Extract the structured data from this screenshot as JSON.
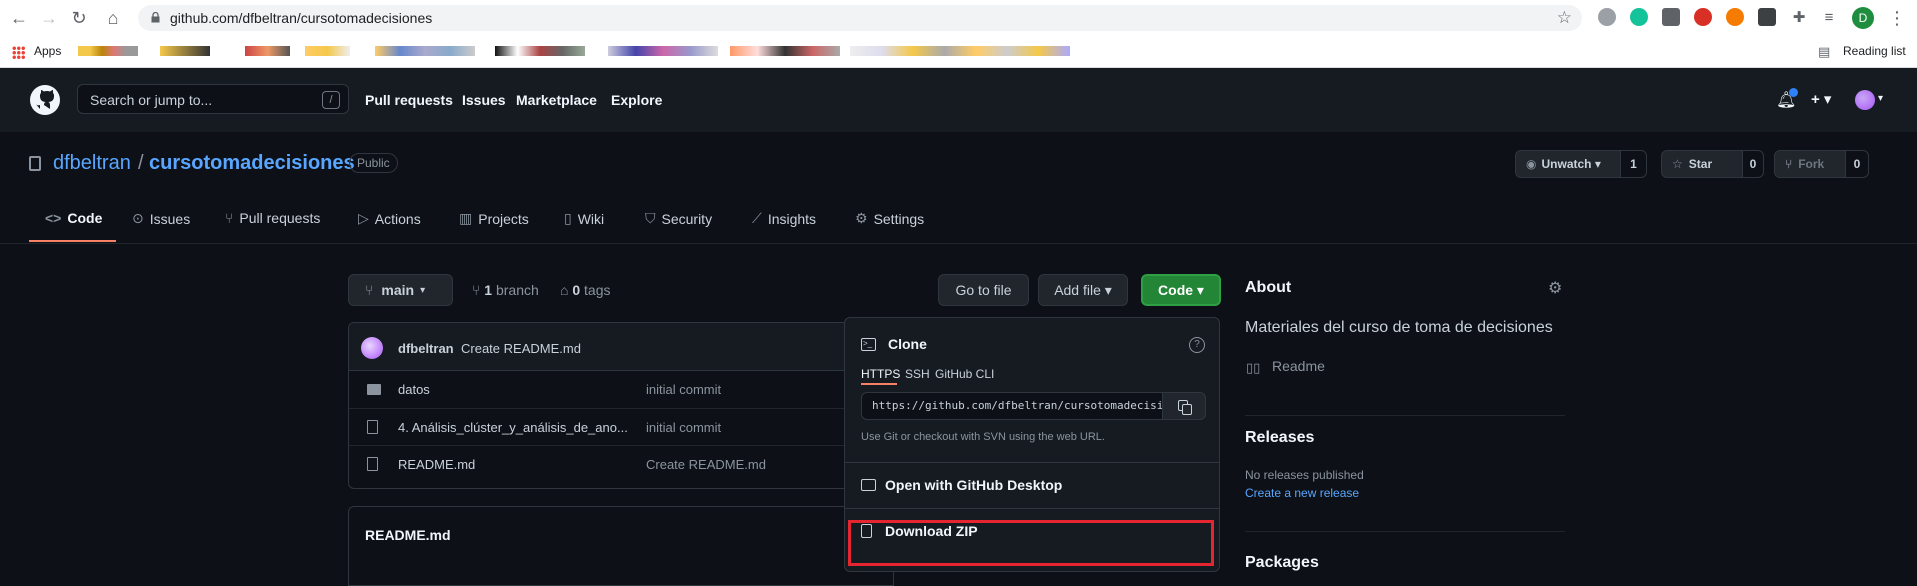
{
  "browser": {
    "url": "github.com/dfbeltran/cursotomadecisiones",
    "apps_label": "Apps",
    "reading_list": "Reading list",
    "profile_initial": "D"
  },
  "gh_header": {
    "search_placeholder": "Search or jump to...",
    "slash": "/",
    "nav": [
      "Pull requests",
      "Issues",
      "Marketplace",
      "Explore"
    ],
    "plus": "+ ▾"
  },
  "repo": {
    "owner": "dfbeltran",
    "separator": "/",
    "name": "cursotomadecisiones",
    "visibility": "Public",
    "unwatch_label": "Unwatch ▾",
    "unwatch_count": "1",
    "star_label": "Star",
    "star_count": "0",
    "fork_label": "Fork",
    "fork_count": "0"
  },
  "tabs": [
    "Code",
    "Issues",
    "Pull requests",
    "Actions",
    "Projects",
    "Wiki",
    "Security",
    "Insights",
    "Settings"
  ],
  "toolbar": {
    "branch": "main",
    "branch_count": "1",
    "branch_word": "branch",
    "tag_count": "0",
    "tag_word": "tags",
    "go_to_file": "Go to file",
    "add_file": "Add file ▾",
    "code": "Code ▾"
  },
  "commit": {
    "author": "dfbeltran",
    "message": "Create README.md"
  },
  "files": [
    {
      "name": "datos",
      "message": "initial commit",
      "type": "folder"
    },
    {
      "name": "4. Análisis_clúster_y_análisis_de_ano...",
      "message": "initial commit",
      "type": "file"
    },
    {
      "name": "README.md",
      "message": "Create README.md",
      "type": "file"
    }
  ],
  "readme_title": "README.md",
  "clone": {
    "title": "Clone",
    "help": "?",
    "tabs": [
      "HTTPS",
      "SSH",
      "GitHub CLI"
    ],
    "url": "https://github.com/dfbeltran/cursotomadecisiones.git",
    "hint": "Use Git or checkout with SVN using the web URL.",
    "open_desktop": "Open with GitHub Desktop",
    "download_zip": "Download ZIP"
  },
  "about": {
    "title": "About",
    "description": "Materiales del curso de toma de decisiones",
    "readme": "Readme",
    "releases_title": "Releases",
    "no_releases": "No releases published",
    "create_release": "Create a new release",
    "packages_title": "Packages"
  },
  "colors": {
    "accent_blue": "#58a6ff",
    "code_green": "#238636",
    "highlight_red": "#e5252f"
  }
}
